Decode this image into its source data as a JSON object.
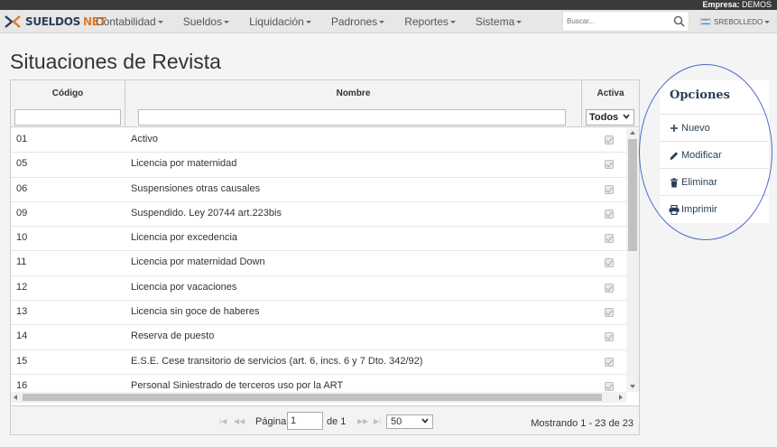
{
  "topbar": {
    "empresa_label": "Empresa:",
    "empresa_value": "DEMOS"
  },
  "brand": {
    "name_a": "SUELDOS",
    "name_b": "NET"
  },
  "menu": [
    {
      "label": "Contabilidad"
    },
    {
      "label": "Sueldos"
    },
    {
      "label": "Liquidación"
    },
    {
      "label": "Padrones"
    },
    {
      "label": "Reportes"
    },
    {
      "label": "Sistema"
    }
  ],
  "search": {
    "placeholder": "Buscar..."
  },
  "user": {
    "name": "SREBOLLEDO"
  },
  "page": {
    "title": "Situaciones de Revista"
  },
  "grid": {
    "columns": {
      "codigo": "Código",
      "nombre": "Nombre",
      "activa": "Activa"
    },
    "activa_filter": "Todos",
    "rows": [
      {
        "codigo": "01",
        "nombre": "Activo",
        "activa": true
      },
      {
        "codigo": "05",
        "nombre": "Licencia por maternidad",
        "activa": true
      },
      {
        "codigo": "06",
        "nombre": "Suspensiones otras causales",
        "activa": true
      },
      {
        "codigo": "09",
        "nombre": "Suspendido. Ley 20744 art.223bis",
        "activa": true
      },
      {
        "codigo": "10",
        "nombre": "Licencia por excedencia",
        "activa": true
      },
      {
        "codigo": "11",
        "nombre": "Licencia por maternidad Down",
        "activa": true
      },
      {
        "codigo": "12",
        "nombre": "Licencia por vacaciones",
        "activa": true
      },
      {
        "codigo": "13",
        "nombre": "Licencia sin goce de haberes",
        "activa": true
      },
      {
        "codigo": "14",
        "nombre": "Reserva de puesto",
        "activa": true
      },
      {
        "codigo": "15",
        "nombre": "E.S.E. Cese transitorio de servicios (art. 6, incs. 6 y 7 Dto. 342/92)",
        "activa": true
      },
      {
        "codigo": "16",
        "nombre": "Personal Siniestrado de terceros uso por la ART",
        "activa": true
      }
    ]
  },
  "pager": {
    "page_label": "Página",
    "page_value": "1",
    "of_label": "de 1",
    "page_size": "50",
    "info": "Mostrando 1 - 23 de 23"
  },
  "opciones": {
    "title": "Opciones",
    "items": [
      {
        "label": "Nuevo",
        "icon": "plus-icon"
      },
      {
        "label": "Modificar",
        "icon": "pencil-icon"
      },
      {
        "label": "Eliminar",
        "icon": "trash-icon"
      },
      {
        "label": "Imprimir",
        "icon": "print-icon"
      }
    ]
  },
  "colors": {
    "brand_navy": "#2b3e57",
    "brand_orange": "#e07a2a",
    "highlight": "#4a6cc9"
  }
}
